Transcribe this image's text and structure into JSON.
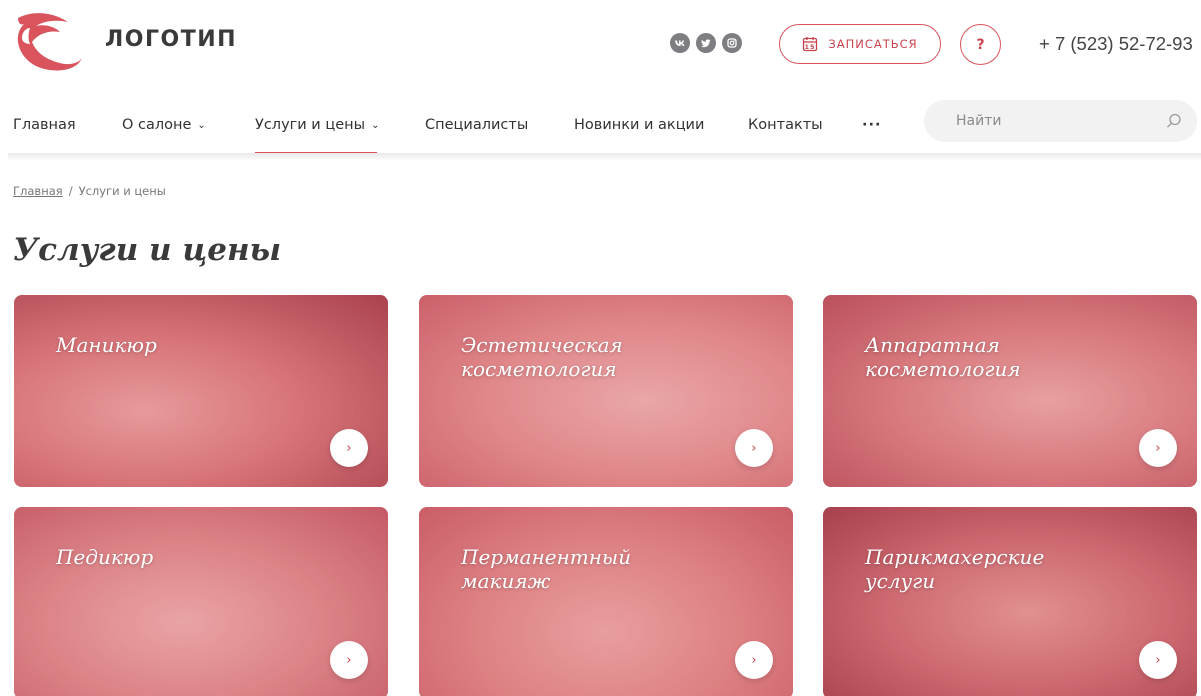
{
  "header": {
    "logo_text": "ЛОГОТИП",
    "signup_label": "ЗАПИСАТЬСЯ",
    "calendar_day": "15",
    "help_label": "?",
    "phone": "+ 7 (523) 52-72-93",
    "socials": [
      "vk-icon",
      "twitter-icon",
      "instagram-icon"
    ]
  },
  "nav": {
    "items": [
      {
        "label": "Главная",
        "dropdown": false
      },
      {
        "label": "О салоне",
        "dropdown": true
      },
      {
        "label": "Услуги и цены",
        "dropdown": true,
        "active": true
      },
      {
        "label": "Специалисты",
        "dropdown": false
      },
      {
        "label": "Новинки и акции",
        "dropdown": false
      },
      {
        "label": "Контакты",
        "dropdown": false
      }
    ],
    "more_label": "···",
    "search_placeholder": "Найти"
  },
  "breadcrumb": {
    "home": "Главная",
    "separator": "/",
    "current": "Услуги и цены"
  },
  "page": {
    "title": "Услуги и цены"
  },
  "cards": [
    {
      "label": "Маникюр"
    },
    {
      "label": "Эстетическая\nкосметология"
    },
    {
      "label": "Аппаратная\nкосметология"
    },
    {
      "label": "Педикюр"
    },
    {
      "label": "Перманентный\nмакияж"
    },
    {
      "label": "Парикмахерские\nуслуги"
    }
  ],
  "colors": {
    "accent": "#d9545c",
    "text": "#333333",
    "card_tint": "#d6505c"
  }
}
